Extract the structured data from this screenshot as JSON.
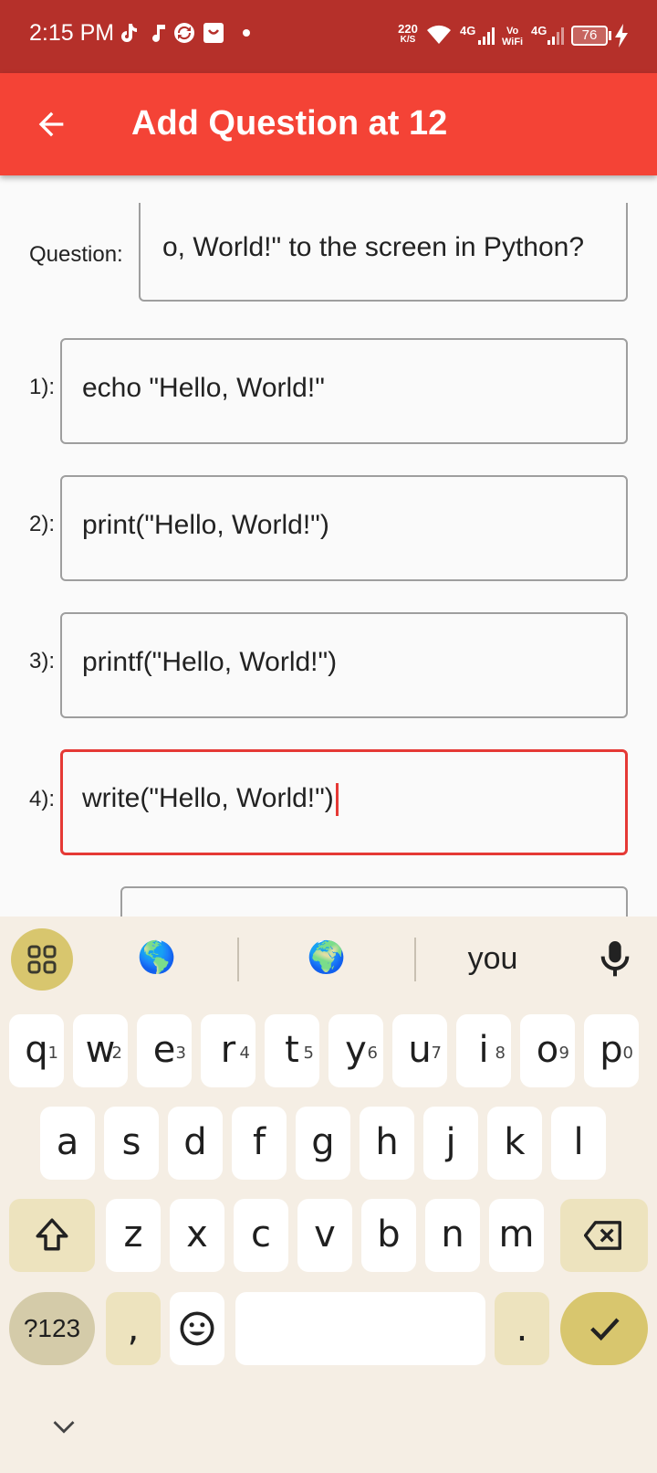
{
  "status_bar": {
    "time": "2:15 PM",
    "net_speed_value": "220",
    "net_speed_unit": "K/S",
    "signal1": "4G",
    "volte_top": "Vo",
    "volte_bottom": "WiFi",
    "signal2": "4G",
    "battery": "76",
    "notification_icons": [
      "tiktok-icon",
      "music-note-icon",
      "sync-icon",
      "shopping-bag-icon",
      "dot-icon"
    ]
  },
  "app_bar": {
    "title": "Add Question at 12",
    "back_icon": "arrow-back-icon",
    "color": "#f44336"
  },
  "form": {
    "question_label": "Question:",
    "question_value": "o, World!\" to the screen in Python?",
    "options": [
      {
        "label": "1):",
        "value": "echo \"Hello, World!\""
      },
      {
        "label": "2):",
        "value": "print(\"Hello, World!\")"
      },
      {
        "label": "3):",
        "value": "printf(\"Hello, World!\")"
      },
      {
        "label": "4):",
        "value": "write(\"Hello, World!\")"
      }
    ],
    "focus_color": "#e53935"
  },
  "keyboard": {
    "suggestions": [
      "🌎",
      "🌍",
      "you"
    ],
    "row1": [
      {
        "k": "q",
        "h": "1"
      },
      {
        "k": "w",
        "h": "2"
      },
      {
        "k": "e",
        "h": "3"
      },
      {
        "k": "r",
        "h": "4"
      },
      {
        "k": "t",
        "h": "5"
      },
      {
        "k": "y",
        "h": "6"
      },
      {
        "k": "u",
        "h": "7"
      },
      {
        "k": "i",
        "h": "8"
      },
      {
        "k": "o",
        "h": "9"
      },
      {
        "k": "p",
        "h": "0"
      }
    ],
    "row2": [
      "a",
      "s",
      "d",
      "f",
      "g",
      "h",
      "j",
      "k",
      "l"
    ],
    "row3": [
      "z",
      "x",
      "c",
      "v",
      "b",
      "n",
      "m"
    ],
    "symbols_label": "?123",
    "comma": ",",
    "period": ".",
    "accent": "#d8c66e"
  }
}
